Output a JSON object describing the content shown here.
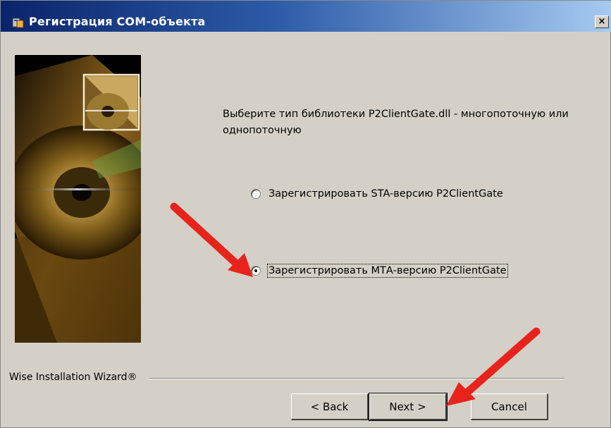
{
  "window": {
    "title": "Регистрация СОМ-объекта",
    "close_glyph": "×"
  },
  "instruction": "Выберите тип библиотеки P2ClientGate.dll - многопоточную или однопоточную",
  "options": [
    {
      "label": "Зарегистрировать STA-версию P2ClientGate",
      "selected": false
    },
    {
      "label": "Зарегистрировать МТА-версию P2ClientGate",
      "selected": true
    }
  ],
  "branding": "Wise Installation Wizard®",
  "buttons": {
    "back": "< Back",
    "next": "Next >",
    "cancel": "Cancel"
  },
  "colors": {
    "titlebar_start": "#0a246a",
    "titlebar_end": "#a6caf0",
    "dialog_bg": "#d4d0c8",
    "annotation_arrow": "#e8231c"
  },
  "icons": [
    "setup-app-icon",
    "close-icon",
    "cd-disc-banner",
    "red-annotation-arrow"
  ]
}
